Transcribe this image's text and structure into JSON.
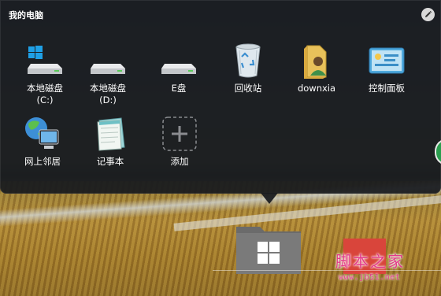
{
  "panel": {
    "title": "我的电脑",
    "edit_icon": "pencil-icon"
  },
  "tiles": [
    {
      "label": "本地磁盘",
      "sub": "(C:)",
      "icon": "windows-drive-icon"
    },
    {
      "label": "本地磁盘",
      "sub": "(D:)",
      "icon": "hard-drive-icon"
    },
    {
      "label": "E盘",
      "sub": "",
      "icon": "hard-drive-icon"
    },
    {
      "label": "回收站",
      "sub": "",
      "icon": "recycle-bin-icon"
    },
    {
      "label": "downxia",
      "sub": "",
      "icon": "user-folder-icon"
    },
    {
      "label": "控制面板",
      "sub": "",
      "icon": "control-panel-icon"
    },
    {
      "label": "网上邻居",
      "sub": "",
      "icon": "network-icon"
    },
    {
      "label": "记事本",
      "sub": "",
      "icon": "notepad-icon"
    },
    {
      "label": "添加",
      "sub": "",
      "icon": "add-icon"
    }
  ],
  "taskbar": {
    "folder_icon": "windows-folder-icon"
  },
  "watermark": {
    "text": "脚本之家",
    "url": "www.jb51.net"
  },
  "colors": {
    "panel_bg": "#181a1e",
    "text": "#ffffff",
    "folder_gray": "#6b6b6b",
    "red_tile": "#d9453b",
    "side_handle": "#2a9d4e",
    "watermark": "#e33a8a"
  }
}
